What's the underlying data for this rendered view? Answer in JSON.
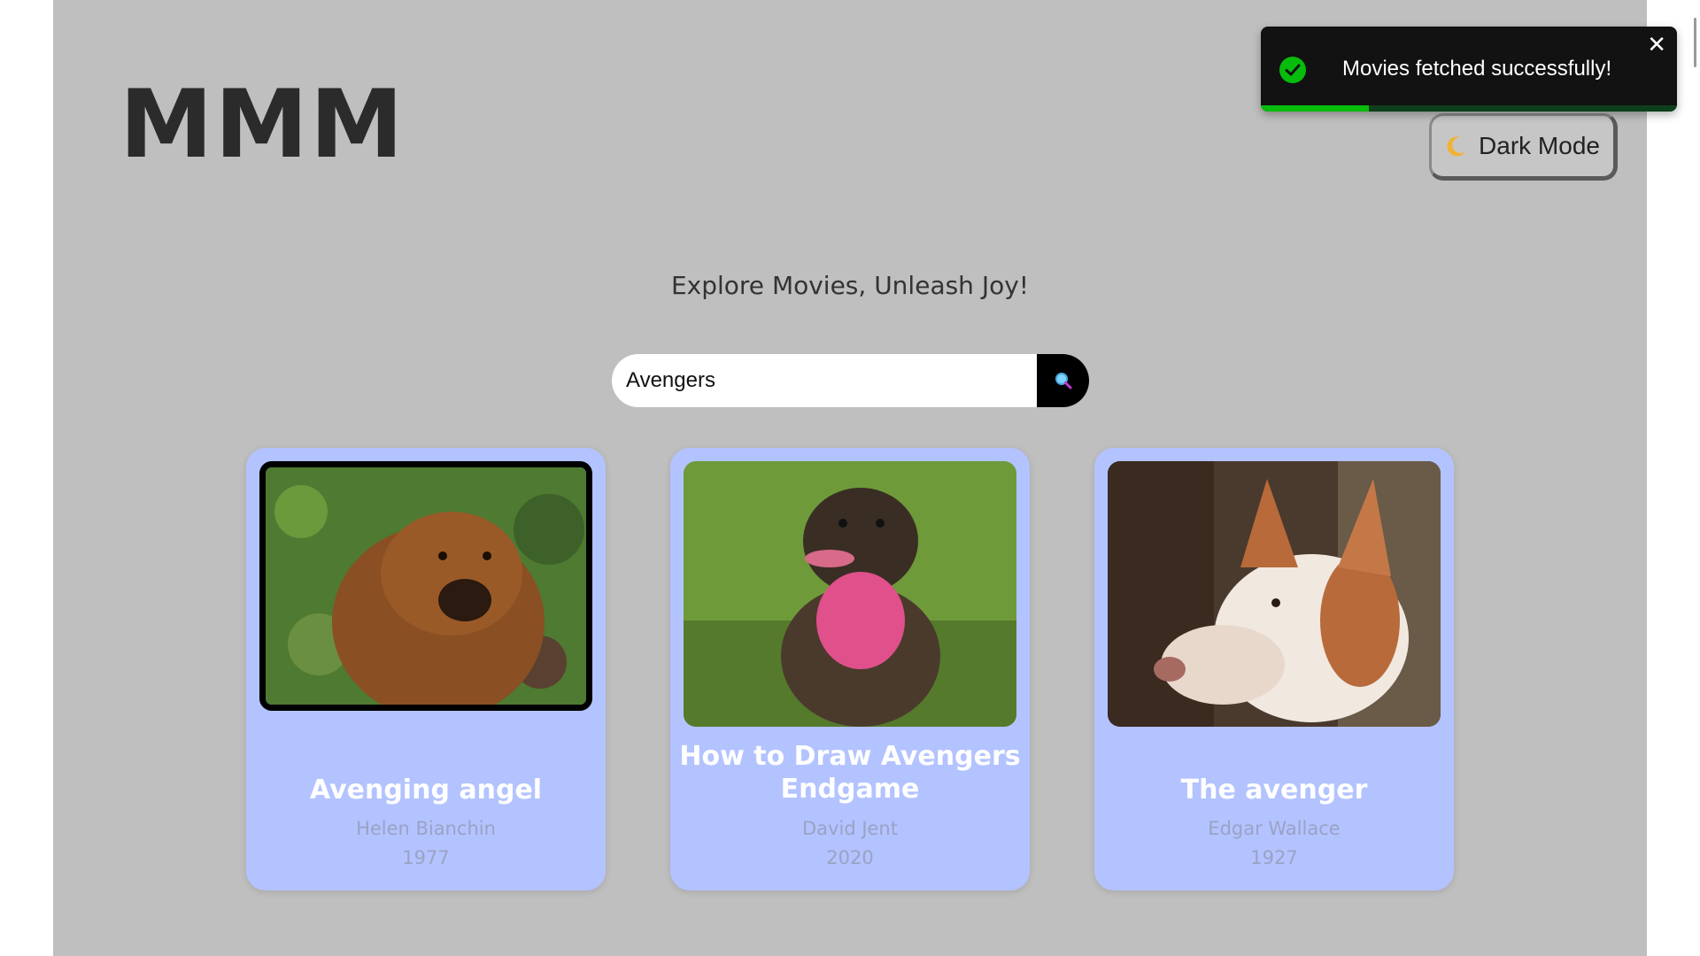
{
  "app": {
    "title": "MMM",
    "tagline": "Explore Movies, Unleash Joy!"
  },
  "theme_toggle": {
    "label": "Dark Mode",
    "icon": "moon-icon"
  },
  "search": {
    "value": "Avengers",
    "icon": "search-icon"
  },
  "toast": {
    "message": "Movies fetched successfully!",
    "close_glyph": "✕",
    "progress": 0.26,
    "icon": "check-circle-icon",
    "accent": "#07bc0c"
  },
  "movies": [
    {
      "title": "Avenging angel",
      "author": "Helen Bianchin",
      "year": "1977"
    },
    {
      "title": "How to Draw Avengers Endgame",
      "author": "David Jent",
      "year": "2020"
    },
    {
      "title": "The avenger",
      "author": "Edgar Wallace",
      "year": "1927"
    }
  ],
  "colors": {
    "page_bg": "#bfbfbf",
    "card_bg": "#b3c3ff",
    "toast_bg": "#121212"
  }
}
